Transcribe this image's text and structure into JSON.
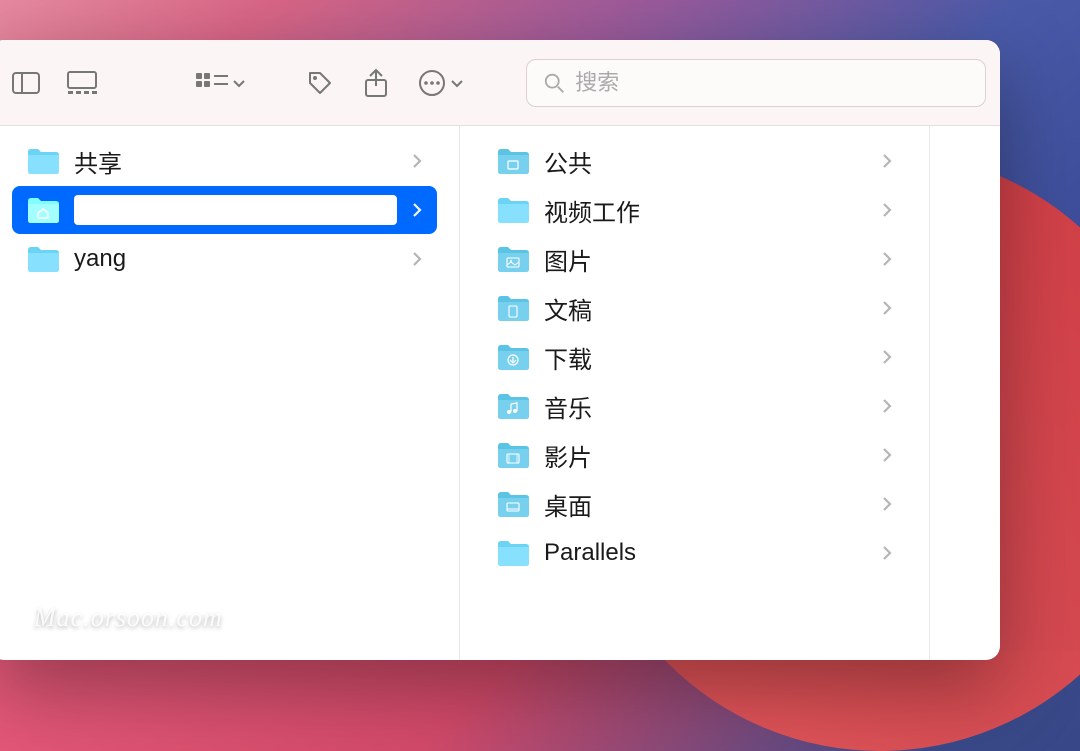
{
  "toolbar": {
    "search_placeholder": "搜索"
  },
  "column_left": [
    {
      "label": "共享",
      "icon": "folder",
      "selected": false
    },
    {
      "label": "",
      "icon": "home-folder",
      "selected": true,
      "editing": true
    },
    {
      "label": "yang",
      "icon": "folder",
      "selected": false
    }
  ],
  "column_right": [
    {
      "label": "公共",
      "icon": "public-folder"
    },
    {
      "label": "视频工作",
      "icon": "folder"
    },
    {
      "label": "图片",
      "icon": "pictures-folder"
    },
    {
      "label": "文稿",
      "icon": "documents-folder"
    },
    {
      "label": "下载",
      "icon": "downloads-folder"
    },
    {
      "label": "音乐",
      "icon": "music-folder"
    },
    {
      "label": "影片",
      "icon": "movies-folder"
    },
    {
      "label": "桌面",
      "icon": "desktop-folder"
    },
    {
      "label": "Parallels",
      "icon": "folder"
    }
  ],
  "watermark": "Mac.orsoon.com"
}
